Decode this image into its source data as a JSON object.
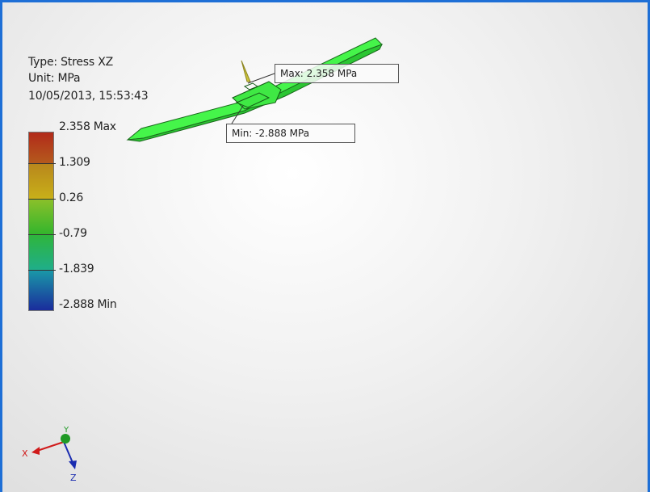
{
  "info": {
    "type": "Type: Stress XZ",
    "unit": "Unit: MPa",
    "date": "10/05/2013, 15:53:43"
  },
  "legend": {
    "labels": [
      "2.358 Max",
      "1.309",
      "0.26",
      "-0.79",
      "-1.839",
      "-2.888 Min"
    ],
    "bands": [
      "#b22a1a",
      "#c8b019",
      "#33b52c",
      "#1fae6b",
      "#1a7fa8",
      "#1a2c9c"
    ]
  },
  "callouts": {
    "max": "Max: 2.358 MPa",
    "min": "Min: -2.888 MPa"
  },
  "triad": {
    "x": "X",
    "y": "Y",
    "z": "Z"
  },
  "colors": {
    "accent_border": "#1e6fd6",
    "model_fill": "#45f54a",
    "model_edge": "#1b6a1d"
  }
}
